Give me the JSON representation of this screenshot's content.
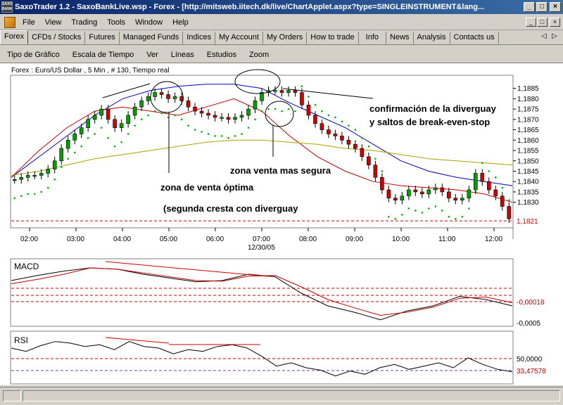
{
  "window": {
    "title": "SaxoTrader 1.2 - SaxoBankLive.wsp - Forex - [http://mitsweb.iitech.dk/live/ChartApplet.aspx?type=SINGLEINSTRUMENT&lang...",
    "app_icon_text": "SAXO BANK",
    "minimize": "_",
    "maximize": "□",
    "close": "×"
  },
  "menubar": {
    "items": [
      "File",
      "View",
      "Trading",
      "Tools",
      "Window",
      "Help"
    ]
  },
  "tabs": {
    "items": [
      "Forex",
      "CFDs / Stocks",
      "Futures",
      "Managed Funds",
      "Indices",
      "My Account",
      "My Orders",
      "How to trade",
      "Info",
      "News",
      "Analysis",
      "Contacts us"
    ],
    "active": "Forex",
    "scroll_left": "◁",
    "scroll_right": "▷"
  },
  "chart_menu": {
    "items": [
      "Tipo de Gráfico",
      "Escala de Tiempo",
      "Ver",
      "Líneas",
      "Estudios",
      "Zoom"
    ]
  },
  "chart_data": [
    {
      "type": "line",
      "subtype": "candlestick",
      "title": "Forex : Euro/US Dollar , 5 Min , # 130, Tiempo real",
      "x_ticks": [
        "02:00",
        "03:00",
        "04:00",
        "05:00",
        "06:00",
        "07:00",
        "08:00",
        "09:00",
        "10:00",
        "11:00",
        "12:00"
      ],
      "date_label": "12/30/05",
      "y_ticks": [
        1.1885,
        1.188,
        1.1875,
        1.187,
        1.1865,
        1.186,
        1.1855,
        1.185,
        1.1845,
        1.184,
        1.1835,
        1.183
      ],
      "y_tick_labels": [
        "1,1885",
        "1,1880",
        "1,1875",
        "1,1870",
        "1,1865",
        "1,1860",
        "1,1855",
        "1,1850",
        "1,1845",
        "1,1840",
        "1,1835",
        "1,1830"
      ],
      "ylim": [
        1.1818,
        1.1891
      ],
      "last_price": 1.1821,
      "last_price_label": "1,1821",
      "candles_close": [
        1.1841,
        1.1842,
        1.1843,
        1.1843,
        1.1844,
        1.1846,
        1.185,
        1.1856,
        1.186,
        1.1863,
        1.1866,
        1.187,
        1.1872,
        1.1875,
        1.187,
        1.1866,
        1.1868,
        1.1872,
        1.1876,
        1.1879,
        1.1881,
        1.1883,
        1.1882,
        1.188,
        1.1881,
        1.1879,
        1.1876,
        1.1874,
        1.1873,
        1.1872,
        1.1871,
        1.1871,
        1.187,
        1.1871,
        1.1872,
        1.1875,
        1.1879,
        1.1883,
        1.1884,
        1.1884,
        1.1883,
        1.1884,
        1.1883,
        1.1877,
        1.1872,
        1.1868,
        1.1865,
        1.1863,
        1.1862,
        1.186,
        1.1858,
        1.1856,
        1.1852,
        1.1848,
        1.1842,
        1.1836,
        1.1832,
        1.1831,
        1.1833,
        1.1836,
        1.1835,
        1.1834,
        1.1836,
        1.1837,
        1.1835,
        1.1832,
        1.1831,
        1.1832,
        1.1836,
        1.1844,
        1.184,
        1.1836,
        1.1833,
        1.1828,
        1.1822
      ],
      "series": [
        {
          "name": "",
          "color": "#0000c0",
          "values": [
            1.1842,
            1.1852,
            1.1862,
            1.1872,
            1.188,
            1.1884,
            1.1886,
            1.1887,
            1.1887,
            1.1885,
            1.1878,
            1.1872,
            1.1866,
            1.1858,
            1.185,
            1.1845,
            1.1842,
            1.184,
            1.1838
          ]
        },
        {
          "name": "",
          "color": "#c00000",
          "values": [
            1.1842,
            1.1855,
            1.1866,
            1.1874,
            1.1876,
            1.1874,
            1.1872,
            1.1876,
            1.188,
            1.1874,
            1.1862,
            1.1852,
            1.1845,
            1.184,
            1.1838,
            1.1837,
            1.1836,
            1.1834,
            1.183
          ]
        },
        {
          "name": "",
          "color": "#b0a000",
          "values": [
            1.1843,
            1.1845,
            1.1848,
            1.1851,
            1.1853,
            1.1855,
            1.1857,
            1.1859,
            1.186,
            1.186,
            1.1859,
            1.1858,
            1.1856,
            1.1855,
            1.1853,
            1.1851,
            1.185,
            1.1849,
            1.1848
          ]
        }
      ],
      "annotations": [
        "confirmación de la diverguay",
        "y saltos de break-even-stop",
        "zona venta mas segura",
        "zona de venta  óptima",
        "(segunda cresta con diverguay"
      ]
    },
    {
      "type": "line",
      "title": "MACD",
      "y_tick_labels": [
        "-0,00018",
        "-0,0005"
      ],
      "reference_level": -0.00018,
      "series": [
        {
          "name": "",
          "color": "#000000",
          "values": [
            0.0001,
            0.00018,
            0.00025,
            0.0003,
            0.00028,
            0.0002,
            0.00014,
            8e-05,
            0.0001,
            0.0002,
            0.00016,
            -0.0001,
            -0.0003,
            -0.0004,
            -0.00052,
            -0.00038,
            -0.0003,
            -0.00015,
            -0.0002,
            -0.0003
          ]
        },
        {
          "name": "",
          "color": "#c00000",
          "values": [
            5e-05,
            0.00012,
            0.0002,
            0.0003,
            0.00028,
            0.00022,
            0.00016,
            0.0001,
            9e-05,
            0.00017,
            0.00018,
            0.0,
            -0.0002,
            -0.00033,
            -0.00045,
            -0.0004,
            -0.00032,
            -0.00018,
            -0.00016,
            -0.00025
          ]
        }
      ]
    },
    {
      "type": "line",
      "title": "RSI",
      "y_tick_labels": [
        "50,0000",
        "33,47578"
      ],
      "reference_levels": [
        50.0,
        33.47578
      ],
      "series": [
        {
          "name": "",
          "color": "#000000",
          "values": [
            62,
            58,
            65,
            70,
            68,
            64,
            66,
            60,
            70,
            64,
            62,
            55,
            60,
            58,
            64,
            66,
            62,
            52,
            40,
            44,
            38,
            35,
            28,
            34,
            30,
            38,
            42,
            36,
            40,
            44,
            38,
            50,
            42,
            36,
            33
          ]
        }
      ]
    }
  ],
  "colors": {
    "titlebar_start": "#0a246a",
    "titlebar_end": "#3a6ea5",
    "bull_candle": "#00a000",
    "bear_candle": "#d00000",
    "sar_dots": "#00b000",
    "dashed_red": "#d00000",
    "dashed_purple": "#6040c0"
  }
}
